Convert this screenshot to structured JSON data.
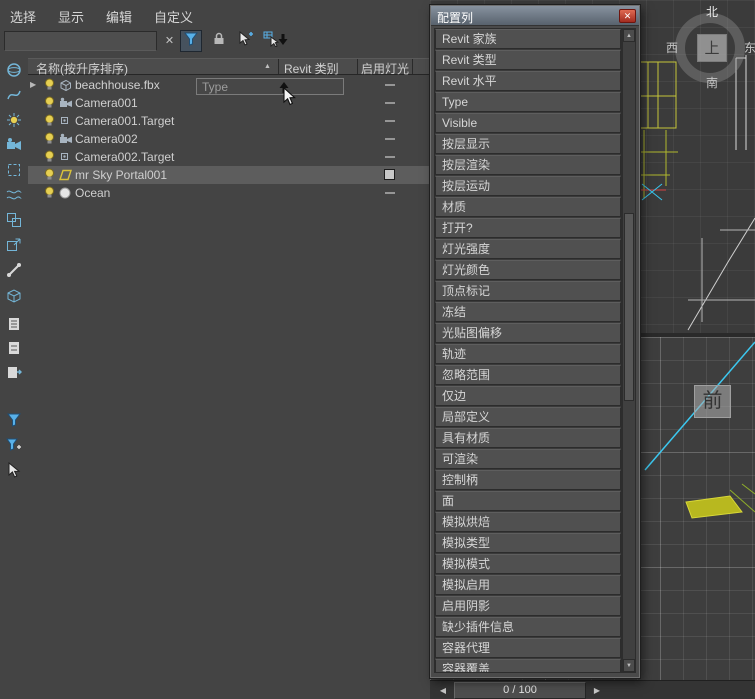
{
  "icons": {
    "close": "✕",
    "clear_search": "✕",
    "sort_asc": "▲",
    "scroll_up": "▲",
    "scroll_down": "▼",
    "prev_frame": "◀",
    "next_frame": "▶",
    "expand": "▶"
  },
  "menubar": {
    "items": [
      "选择",
      "显示",
      "编辑",
      "自定义"
    ]
  },
  "search": {
    "value": ""
  },
  "explorer": {
    "columns": {
      "name": "名称(按升序排序)",
      "revit": "Revit 类别",
      "light": "启用灯光"
    },
    "rows": [
      {
        "name": "beachhouse.fbx",
        "icon": "geometry-box",
        "expandable": true,
        "light": "dash"
      },
      {
        "name": "Camera001",
        "icon": "camera",
        "light": "dash"
      },
      {
        "name": "Camera001.Target",
        "icon": "target",
        "light": "dash"
      },
      {
        "name": "Camera002",
        "icon": "camera",
        "light": "dash"
      },
      {
        "name": "Camera002.Target",
        "icon": "target",
        "light": "dash"
      },
      {
        "name": "mr Sky Portal001",
        "icon": "sky-portal",
        "light": "checkbox",
        "selected": true
      },
      {
        "name": "Ocean",
        "icon": "sphere",
        "light": "dash"
      }
    ],
    "drag_ghost_label": "Type",
    "left_toolbar_icons": [
      "display-geometry-icon",
      "display-shapes-icon",
      "display-lights-icon",
      "display-cameras-icon",
      "display-helpers-icon",
      "display-space-warps-icon",
      "display-groups-icon",
      "display-xrefs-icon",
      "display-bones-icon",
      "display-containers-icon",
      "expand-all-icon",
      "collapse-all-icon",
      "sync-selection-icon",
      "filter-funnel-icon",
      "filter-set-icon",
      "pick-filter-icon"
    ]
  },
  "columns_dialog": {
    "title": "配置列",
    "items": [
      "Revit 家族",
      "Revit 类型",
      "Revit 水平",
      "Type",
      "Visible",
      "按层显示",
      "按层渲染",
      "按层运动",
      "材质",
      "打开?",
      "灯光强度",
      "灯光颜色",
      "顶点标记",
      "冻结",
      "光贴图偏移",
      "轨迹",
      "忽略范围",
      "仅边",
      "局部定义",
      "具有材质",
      "可渲染",
      "控制柄",
      "面",
      "模拟烘焙",
      "模拟类型",
      "模拟模式",
      "模拟启用",
      "启用阴影",
      "缺少插件信息",
      "容器代理",
      "容器覆盖"
    ]
  },
  "viewport": {
    "compass": {
      "north": "北",
      "south": "南",
      "east": "东",
      "west": "西",
      "cube_face": "上"
    },
    "ortho_face_label": "前"
  },
  "timebar": {
    "frame_display": "0 / 100"
  }
}
